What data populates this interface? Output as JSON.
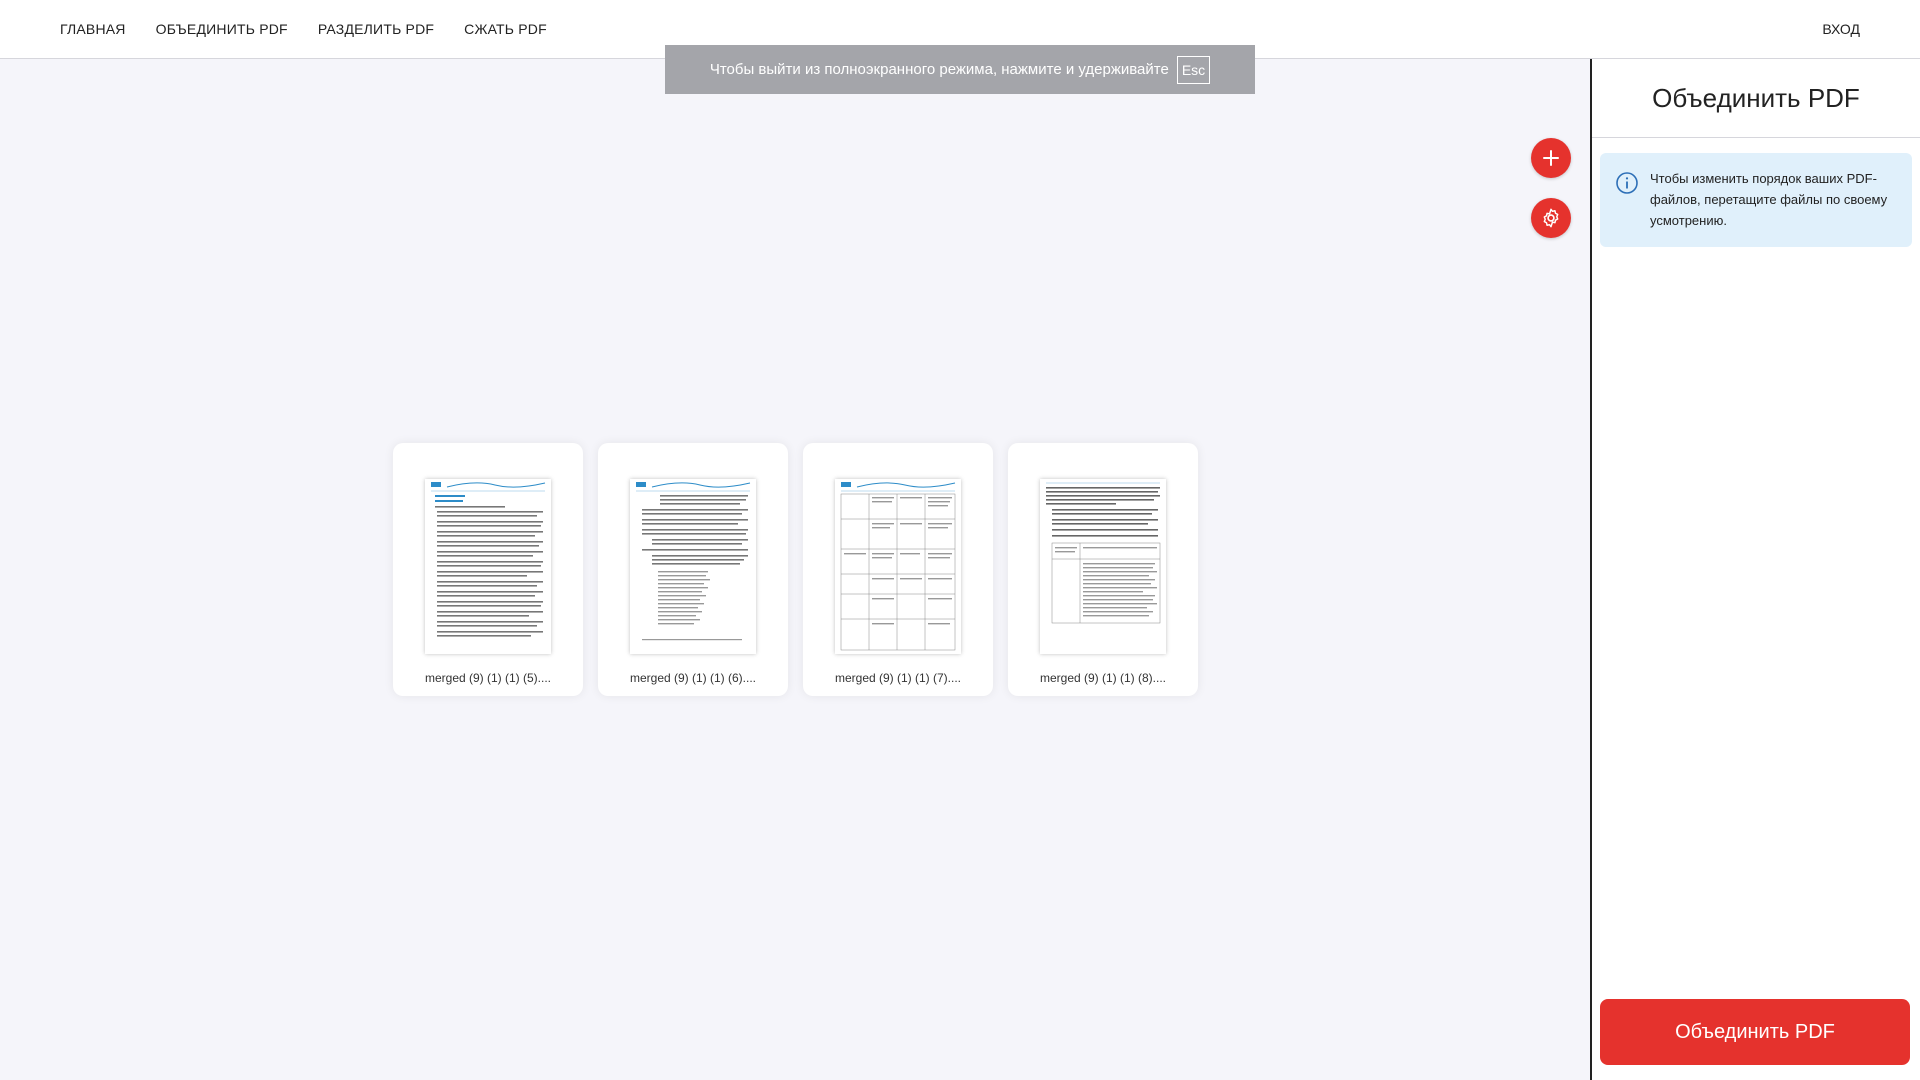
{
  "nav": {
    "items": [
      {
        "label": "ГЛАВНАЯ"
      },
      {
        "label": "ОБЪЕДИНИТЬ PDF"
      },
      {
        "label": "РАЗДЕЛИТЬ PDF"
      },
      {
        "label": "СЖАТЬ PDF"
      }
    ],
    "login": "ВХОД"
  },
  "fullscreen_notice": {
    "text": "Чтобы выйти из полноэкранного режима, нажмите и удерживайте",
    "key": "Esc"
  },
  "files": [
    {
      "name": "merged (9) (1) (1) (5)...."
    },
    {
      "name": "merged (9) (1) (1) (6)...."
    },
    {
      "name": "merged (9) (1) (1) (7)...."
    },
    {
      "name": "merged (9) (1) (1) (8)...."
    }
  ],
  "sidebar": {
    "title": "Объединить PDF",
    "info": "Чтобы изменить порядок ваших PDF-файлов, перетащите файлы по своему усмотрению.",
    "merge_button": "Объединить PDF"
  },
  "colors": {
    "accent": "#e5322d",
    "info_bg": "#e0f0fb",
    "workspace_bg": "#f5f5fa"
  },
  "icons": [
    "plus-icon",
    "gear-icon",
    "info-icon"
  ]
}
